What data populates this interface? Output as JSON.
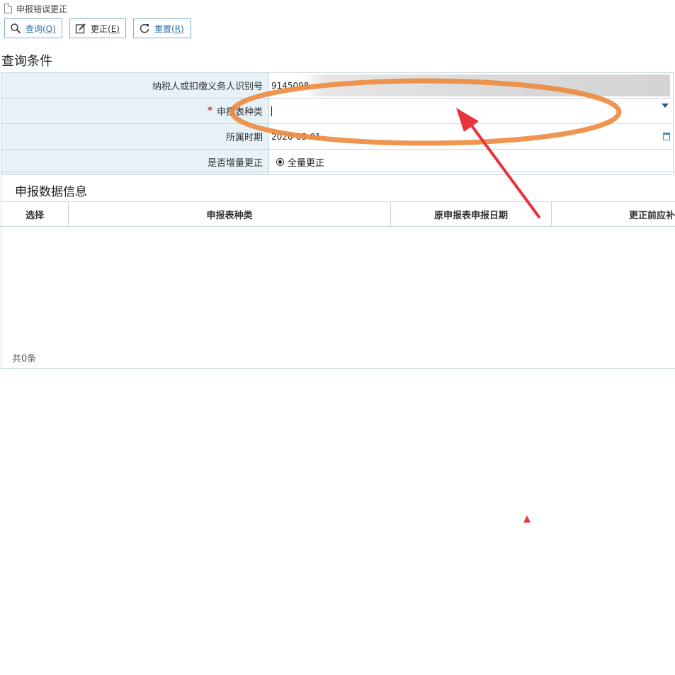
{
  "breadcrumb": {
    "title": "申报错误更正",
    "icon": "doc-icon"
  },
  "toolbar": {
    "buttons": [
      {
        "label": "查询",
        "key": "(Q)",
        "icon": "search-icon"
      },
      {
        "label": "更正",
        "key": "(E)",
        "icon": "edit-icon"
      },
      {
        "label": "重置",
        "key": "(R)",
        "icon": "refresh-icon"
      }
    ]
  },
  "query": {
    "title": "查询条件",
    "fields": [
      {
        "label": "纳税人或扣缴义务人识别号",
        "value": "9145098"
      },
      {
        "label": "申报表种类",
        "required_mark": "*",
        "value": ""
      },
      {
        "label": "所属时期",
        "value": "2020-05-01"
      },
      {
        "label": "是否增量更正",
        "value": "全量更正"
      }
    ]
  },
  "result": {
    "title": "申报数据信息",
    "columns": [
      "选择",
      "申报表种类",
      "原申报表申报日期",
      "更正前应补"
    ],
    "rows": [],
    "footer": "共0条"
  },
  "colors": {
    "annotation_ellipse": "#ee8a3c",
    "annotation_arrow": "#e8323c",
    "label_bg": "#e6f1f8",
    "button_border": "#7fb0cc"
  }
}
